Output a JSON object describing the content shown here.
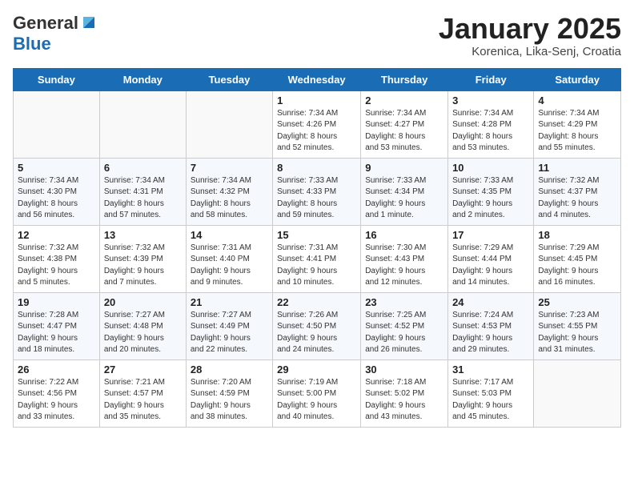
{
  "header": {
    "logo_general": "General",
    "logo_blue": "Blue",
    "month": "January 2025",
    "location": "Korenica, Lika-Senj, Croatia"
  },
  "weekdays": [
    "Sunday",
    "Monday",
    "Tuesday",
    "Wednesday",
    "Thursday",
    "Friday",
    "Saturday"
  ],
  "weeks": [
    [
      {
        "day": "",
        "info": ""
      },
      {
        "day": "",
        "info": ""
      },
      {
        "day": "",
        "info": ""
      },
      {
        "day": "1",
        "info": "Sunrise: 7:34 AM\nSunset: 4:26 PM\nDaylight: 8 hours\nand 52 minutes."
      },
      {
        "day": "2",
        "info": "Sunrise: 7:34 AM\nSunset: 4:27 PM\nDaylight: 8 hours\nand 53 minutes."
      },
      {
        "day": "3",
        "info": "Sunrise: 7:34 AM\nSunset: 4:28 PM\nDaylight: 8 hours\nand 53 minutes."
      },
      {
        "day": "4",
        "info": "Sunrise: 7:34 AM\nSunset: 4:29 PM\nDaylight: 8 hours\nand 55 minutes."
      }
    ],
    [
      {
        "day": "5",
        "info": "Sunrise: 7:34 AM\nSunset: 4:30 PM\nDaylight: 8 hours\nand 56 minutes."
      },
      {
        "day": "6",
        "info": "Sunrise: 7:34 AM\nSunset: 4:31 PM\nDaylight: 8 hours\nand 57 minutes."
      },
      {
        "day": "7",
        "info": "Sunrise: 7:34 AM\nSunset: 4:32 PM\nDaylight: 8 hours\nand 58 minutes."
      },
      {
        "day": "8",
        "info": "Sunrise: 7:33 AM\nSunset: 4:33 PM\nDaylight: 8 hours\nand 59 minutes."
      },
      {
        "day": "9",
        "info": "Sunrise: 7:33 AM\nSunset: 4:34 PM\nDaylight: 9 hours\nand 1 minute."
      },
      {
        "day": "10",
        "info": "Sunrise: 7:33 AM\nSunset: 4:35 PM\nDaylight: 9 hours\nand 2 minutes."
      },
      {
        "day": "11",
        "info": "Sunrise: 7:32 AM\nSunset: 4:37 PM\nDaylight: 9 hours\nand 4 minutes."
      }
    ],
    [
      {
        "day": "12",
        "info": "Sunrise: 7:32 AM\nSunset: 4:38 PM\nDaylight: 9 hours\nand 5 minutes."
      },
      {
        "day": "13",
        "info": "Sunrise: 7:32 AM\nSunset: 4:39 PM\nDaylight: 9 hours\nand 7 minutes."
      },
      {
        "day": "14",
        "info": "Sunrise: 7:31 AM\nSunset: 4:40 PM\nDaylight: 9 hours\nand 9 minutes."
      },
      {
        "day": "15",
        "info": "Sunrise: 7:31 AM\nSunset: 4:41 PM\nDaylight: 9 hours\nand 10 minutes."
      },
      {
        "day": "16",
        "info": "Sunrise: 7:30 AM\nSunset: 4:43 PM\nDaylight: 9 hours\nand 12 minutes."
      },
      {
        "day": "17",
        "info": "Sunrise: 7:29 AM\nSunset: 4:44 PM\nDaylight: 9 hours\nand 14 minutes."
      },
      {
        "day": "18",
        "info": "Sunrise: 7:29 AM\nSunset: 4:45 PM\nDaylight: 9 hours\nand 16 minutes."
      }
    ],
    [
      {
        "day": "19",
        "info": "Sunrise: 7:28 AM\nSunset: 4:47 PM\nDaylight: 9 hours\nand 18 minutes."
      },
      {
        "day": "20",
        "info": "Sunrise: 7:27 AM\nSunset: 4:48 PM\nDaylight: 9 hours\nand 20 minutes."
      },
      {
        "day": "21",
        "info": "Sunrise: 7:27 AM\nSunset: 4:49 PM\nDaylight: 9 hours\nand 22 minutes."
      },
      {
        "day": "22",
        "info": "Sunrise: 7:26 AM\nSunset: 4:50 PM\nDaylight: 9 hours\nand 24 minutes."
      },
      {
        "day": "23",
        "info": "Sunrise: 7:25 AM\nSunset: 4:52 PM\nDaylight: 9 hours\nand 26 minutes."
      },
      {
        "day": "24",
        "info": "Sunrise: 7:24 AM\nSunset: 4:53 PM\nDaylight: 9 hours\nand 29 minutes."
      },
      {
        "day": "25",
        "info": "Sunrise: 7:23 AM\nSunset: 4:55 PM\nDaylight: 9 hours\nand 31 minutes."
      }
    ],
    [
      {
        "day": "26",
        "info": "Sunrise: 7:22 AM\nSunset: 4:56 PM\nDaylight: 9 hours\nand 33 minutes."
      },
      {
        "day": "27",
        "info": "Sunrise: 7:21 AM\nSunset: 4:57 PM\nDaylight: 9 hours\nand 35 minutes."
      },
      {
        "day": "28",
        "info": "Sunrise: 7:20 AM\nSunset: 4:59 PM\nDaylight: 9 hours\nand 38 minutes."
      },
      {
        "day": "29",
        "info": "Sunrise: 7:19 AM\nSunset: 5:00 PM\nDaylight: 9 hours\nand 40 minutes."
      },
      {
        "day": "30",
        "info": "Sunrise: 7:18 AM\nSunset: 5:02 PM\nDaylight: 9 hours\nand 43 minutes."
      },
      {
        "day": "31",
        "info": "Sunrise: 7:17 AM\nSunset: 5:03 PM\nDaylight: 9 hours\nand 45 minutes."
      },
      {
        "day": "",
        "info": ""
      }
    ]
  ]
}
